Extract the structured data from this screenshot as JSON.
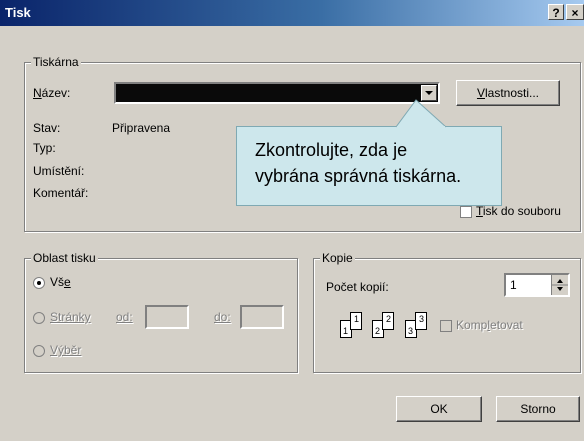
{
  "window": {
    "title": "Tisk",
    "help_label": "?",
    "close_label": "×"
  },
  "printer_group": {
    "label": "Tiskárna",
    "name_label": "Název:",
    "name_value": "",
    "properties_button": "Vlastnosti...",
    "status_label": "Stav:",
    "status_value": "Připravena",
    "type_label": "Typ:",
    "location_label": "Umístění:",
    "comment_label": "Komentář:",
    "print_to_file_label": "Tisk do souboru"
  },
  "callout": {
    "line1": "Zkontrolujte, zda je",
    "line2": "vybrána správná tiskárna."
  },
  "range_group": {
    "label": "Oblast tisku",
    "all_label": "Vše",
    "pages_label": "Stránky",
    "from_label": "od:",
    "to_label": "do:",
    "selection_label": "Výběr"
  },
  "copies_group": {
    "label": "Kopie",
    "count_label": "Počet kopií:",
    "count_value": "1",
    "collate_label": "Kompletovat",
    "page_numbers": [
      "1",
      "1",
      "2",
      "2",
      "3",
      "3"
    ]
  },
  "buttons": {
    "ok": "OK",
    "cancel": "Storno"
  }
}
